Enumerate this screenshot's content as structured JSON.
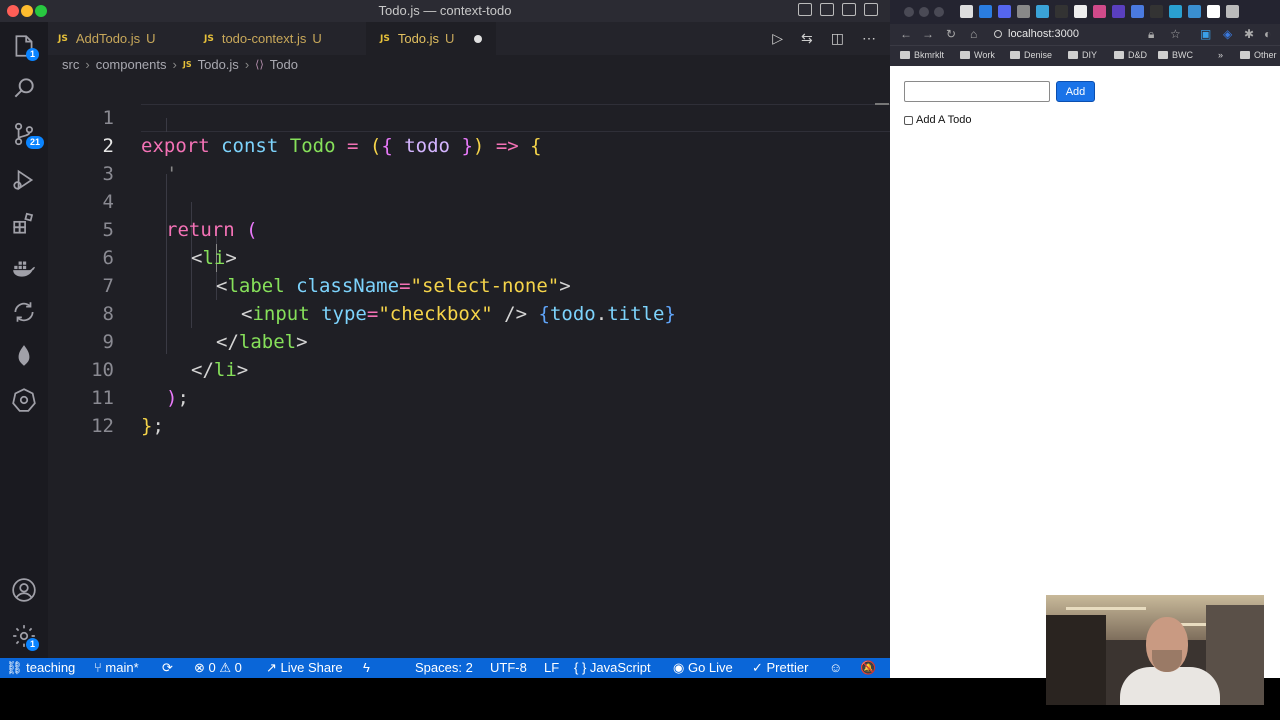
{
  "window": {
    "title": "Todo.js — context-todo"
  },
  "activity_bar": {
    "source_control_badge": "21",
    "manage_badge": "1",
    "explorer_badge": "1"
  },
  "tabs": [
    {
      "icon": "JS",
      "label": "AddTodo.js",
      "status": "U"
    },
    {
      "icon": "JS",
      "label": "todo-context.js",
      "status": "U"
    },
    {
      "icon": "JS",
      "label": "Todo.js",
      "status": "U"
    }
  ],
  "breadcrumb": {
    "folder1": "src",
    "folder2": "components",
    "file_icon": "JS",
    "file": "Todo.js",
    "symbol": "Todo"
  },
  "editor": {
    "line_numbers": [
      "1",
      "2",
      "3",
      "4",
      "5",
      "6",
      "7",
      "8",
      "9",
      "10",
      "11",
      "12"
    ],
    "code": {
      "l1_export": "export",
      "l1_const": "const",
      "l1_name": "Todo",
      "l1_eq": "=",
      "l1_open_paren": "(",
      "l1_open_brace": "{",
      "l1_param": "todo",
      "l1_close_brace": "}",
      "l1_close_paren": ")",
      "l1_arrow": "=>",
      "l1_body_brace": "{",
      "l2_text": "'",
      "l4_return": "return",
      "l4_paren": "(",
      "l5_open": "<",
      "l5_tag": "li",
      "l5_close": ">",
      "l6_open": "<",
      "l6_tag": "label",
      "l6_attr": "className",
      "l6_eq": "=",
      "l6_str": "\"select-none\"",
      "l6_close": ">",
      "l7_open": "<",
      "l7_tag": "input",
      "l7_attr": "type",
      "l7_eq": "=",
      "l7_str": "\"checkbox\"",
      "l7_selfclose": "/>",
      "l7_brace_open": "{",
      "l7_expr_obj": "todo",
      "l7_dot": ".",
      "l7_expr_prop": "title",
      "l7_brace_close": "}",
      "l8_open": "</",
      "l8_tag": "label",
      "l8_close": ">",
      "l9_open": "</",
      "l9_tag": "li",
      "l9_close": ">",
      "l10_paren": ")",
      "l10_semi": ";",
      "l11_brace": "}",
      "l11_semi": ";"
    }
  },
  "status_bar": {
    "remote": "teaching",
    "branch": "main*",
    "errors": "0",
    "warnings": "0",
    "live_share": "Live Share",
    "spaces": "Spaces: 2",
    "encoding": "UTF-8",
    "eol": "LF",
    "language": "JavaScript",
    "go_live": "Go Live",
    "prettier": "Prettier"
  },
  "browser": {
    "url": "localhost:3000",
    "bookmarks": [
      "Bkmrklt",
      "Work",
      "Denise",
      "DIY",
      "D&D",
      "BWC",
      "»",
      "Other"
    ],
    "app": {
      "add_button": "Add",
      "input_value": "",
      "todo_label": "Add A Todo",
      "todo_checked": false
    }
  },
  "colors": {
    "status_bar": "#0a66d8",
    "add_button": "#1a73e8",
    "editor_bg": "#1f1f25"
  }
}
